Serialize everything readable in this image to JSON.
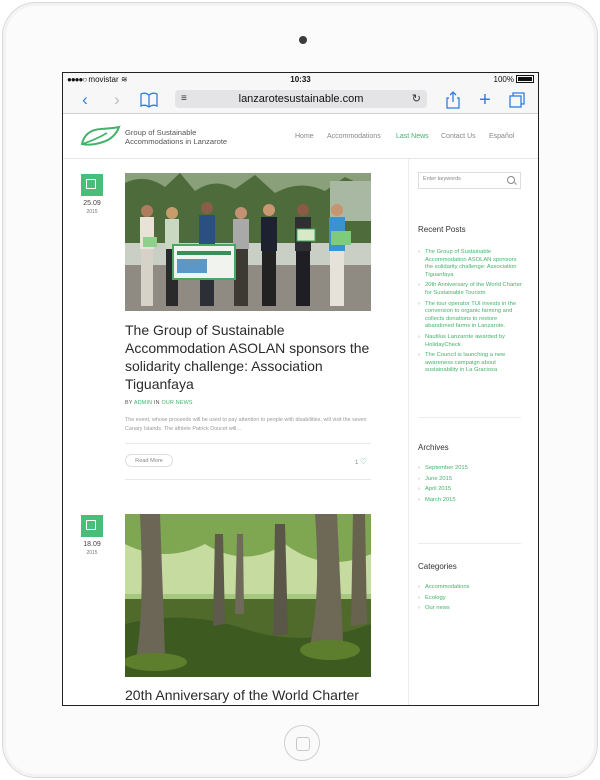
{
  "status_bar": {
    "carrier": "movistar",
    "time": "10:33",
    "battery": "100%"
  },
  "browser": {
    "url": "lanzarotesustainable.com"
  },
  "site": {
    "title_line1": "Group of Sustainable",
    "title_line2": "Accommodations in Lanzarote",
    "nav": [
      "Home",
      "Accommodations",
      "Last News",
      "Contact Us",
      "Español"
    ],
    "active_nav": "Last News"
  },
  "posts": [
    {
      "day": "25.09",
      "year": "2015",
      "title": "The Group of Sustainable Accommodation ASOLAN sponsors the solidarity challenge: Association Tiguanfaya",
      "meta_by": "BY",
      "author": "ADMIN",
      "meta_in": "IN",
      "category": "OUR NEWS",
      "excerpt": "The event, whose proceeds will be used to pay attention to people with disabilities, will visit the seven Canary Islands. The athlete Patrick Doucet will…",
      "read_more": "Read More",
      "likes": "1"
    },
    {
      "day": "18.09",
      "year": "2015",
      "title": "20th Anniversary of the World Charter"
    }
  ],
  "sidebar": {
    "search_placeholder": "Enter keywords",
    "recent_title": "Recent Posts",
    "recent": [
      "The Group of Sustainable Accommodation ASOLAN sponsors the solidarity challenge: Association Tiguanfaya",
      "20th Anniversary of the World Charter for Sustainable Tourism",
      "The tour operator TUI invests in the conversion to organic farming and collects donations to restore abandoned farms in Lanzarote.",
      "Nautilus Lanzarote awarded by HolidayCheck",
      "The Council is launching a new awareness campaign about sustainability in La Graciosa"
    ],
    "archives_title": "Archives",
    "archives": [
      "September 2015",
      "June 2015",
      "April 2015",
      "March 2015"
    ],
    "categories_title": "Categories",
    "categories": [
      "Accommodations",
      "Ecology",
      "Our news"
    ]
  },
  "colors": {
    "accent": "#41b36b",
    "ios_blue": "#2f7de1"
  }
}
